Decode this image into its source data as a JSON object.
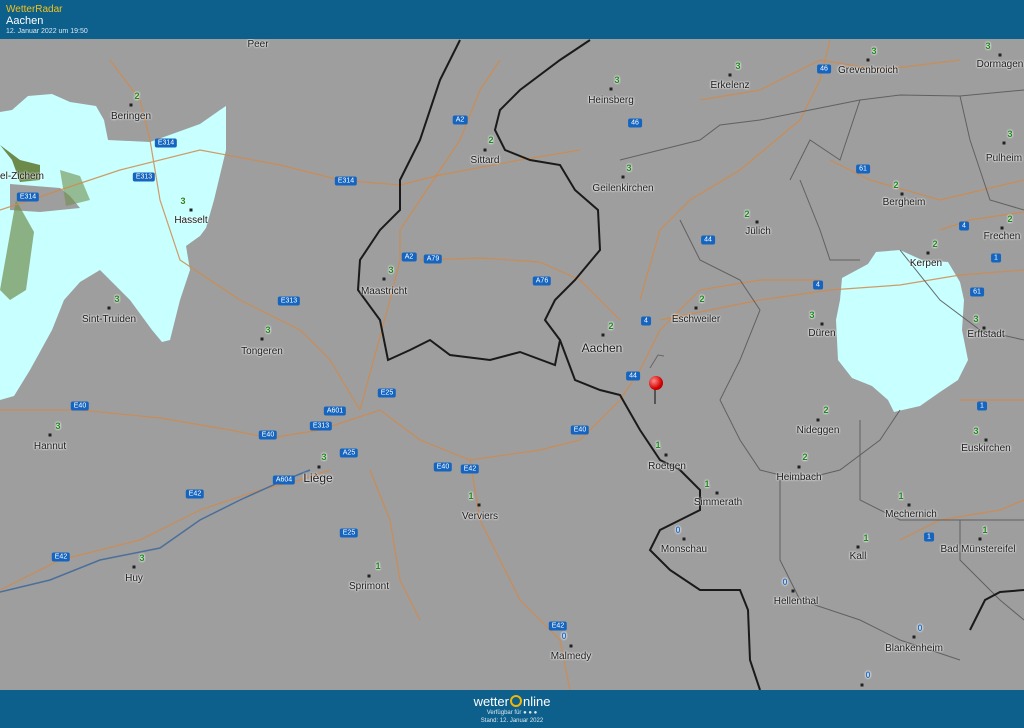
{
  "header": {
    "app_title": "WetterRadar",
    "location": "Aachen",
    "datetime": "12. Januar 2022 um 19:50"
  },
  "footer": {
    "brand_pre": "wetter",
    "brand_post": "nline",
    "available": "Verfügbar für  ●  ●  ●",
    "status": "Stand: 12. Januar 2022"
  },
  "colors": {
    "bar": "#0d5f8c",
    "title_accent": "#f4c21a",
    "radar": "#c8ffff",
    "map": "#9e9e9e",
    "road_badge": "#1565c0",
    "pin": "#d40000"
  },
  "cities": [
    {
      "name": "Peer",
      "temp": ""
    },
    {
      "name": "Beringen",
      "temp": "2"
    },
    {
      "name": "el-Zichem",
      "temp": ""
    },
    {
      "name": "Hasselt",
      "temp": "3"
    },
    {
      "name": "Sint-Truiden",
      "temp": "3"
    },
    {
      "name": "Tongeren",
      "temp": "3"
    },
    {
      "name": "Hannut",
      "temp": "3"
    },
    {
      "name": "Huy",
      "temp": "3"
    },
    {
      "name": "Liège",
      "temp": "3"
    },
    {
      "name": "Sprimont",
      "temp": "1"
    },
    {
      "name": "Verviers",
      "temp": "1"
    },
    {
      "name": "Malmedy",
      "temp": "0"
    },
    {
      "name": "Maastricht",
      "temp": "3"
    },
    {
      "name": "Sittard",
      "temp": "2"
    },
    {
      "name": "Heinsberg",
      "temp": "3"
    },
    {
      "name": "Geilenkirchen",
      "temp": "3"
    },
    {
      "name": "Erkelenz",
      "temp": "3"
    },
    {
      "name": "Grevenbroich",
      "temp": "3"
    },
    {
      "name": "Dormagen",
      "temp": "3"
    },
    {
      "name": "Pulheim",
      "temp": "3"
    },
    {
      "name": "Frechen",
      "temp": "2"
    },
    {
      "name": "Bergheim",
      "temp": "2"
    },
    {
      "name": "Jülich",
      "temp": "2"
    },
    {
      "name": "Kerpen",
      "temp": "2"
    },
    {
      "name": "Erftstadt",
      "temp": "3"
    },
    {
      "name": "Eschweiler",
      "temp": "2"
    },
    {
      "name": "Aachen",
      "temp": "2"
    },
    {
      "name": "Düren",
      "temp": "3"
    },
    {
      "name": "Nideggen",
      "temp": "2"
    },
    {
      "name": "Euskirchen",
      "temp": "3"
    },
    {
      "name": "Roetgen",
      "temp": "1"
    },
    {
      "name": "Simmerath",
      "temp": "1"
    },
    {
      "name": "Heimbach",
      "temp": "2"
    },
    {
      "name": "Mechernich",
      "temp": "1"
    },
    {
      "name": "Monschau",
      "temp": "0"
    },
    {
      "name": "Kall",
      "temp": "1"
    },
    {
      "name": "Bad Münstereifel",
      "temp": "1"
    },
    {
      "name": "Hellenthal",
      "temp": "0"
    },
    {
      "name": "Blankenheim",
      "temp": "0"
    },
    {
      "name": "",
      "temp": "0"
    }
  ],
  "roads": [
    "E314",
    "E313",
    "E314",
    "E314",
    "E313",
    "A2",
    "A2",
    "A79",
    "A76",
    "E25",
    "A601",
    "E40",
    "E40",
    "E313",
    "A25",
    "A604",
    "E42",
    "E40",
    "E42",
    "E25",
    "E42",
    "E42",
    "E40",
    "46",
    "46",
    "44",
    "44",
    "4",
    "4",
    "4",
    "61",
    "61",
    "1",
    "1",
    "1",
    "4"
  ]
}
